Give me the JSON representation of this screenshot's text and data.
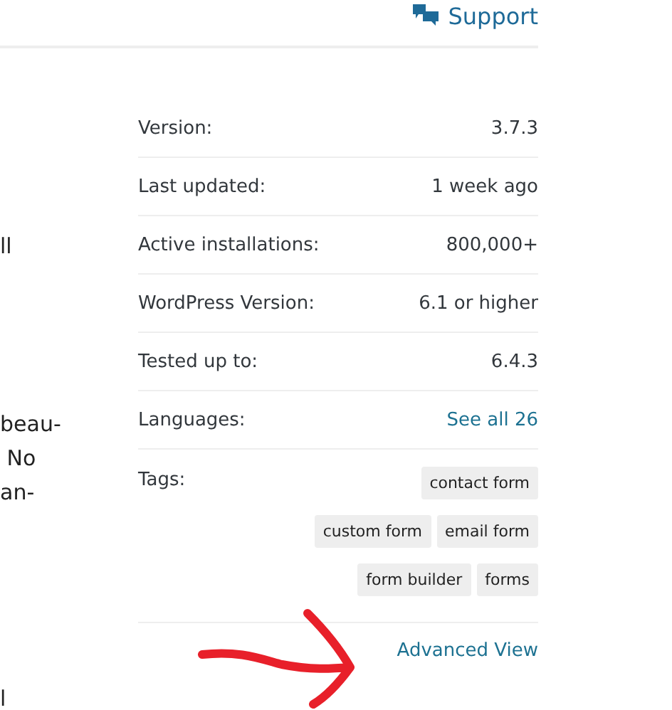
{
  "header": {
    "support_link": "Support"
  },
  "body_fragments": [
    {
      "text": "ll"
    },
    {
      "text": "beau-"
    },
    {
      "text": " No"
    },
    {
      "text": "an-"
    },
    {
      "text": "l"
    }
  ],
  "details": [
    {
      "label": "Version:",
      "value": "3.7.3",
      "kind": "text"
    },
    {
      "label": "Last updated:",
      "value": "1 week ago",
      "kind": "text"
    },
    {
      "label": "Active installations:",
      "value": "800,000+",
      "kind": "text"
    },
    {
      "label": "WordPress Version:",
      "value": "6.1 or higher",
      "kind": "text"
    },
    {
      "label": "Tested up to:",
      "value": "6.4.3",
      "kind": "text"
    },
    {
      "label": "Languages:",
      "value": "See all 26",
      "kind": "link"
    }
  ],
  "tags": {
    "label": "Tags:",
    "rows": [
      [
        "contact form"
      ],
      [
        "custom form",
        "email form"
      ],
      [
        "form builder",
        "forms"
      ]
    ]
  },
  "advanced_view": "Advanced View"
}
